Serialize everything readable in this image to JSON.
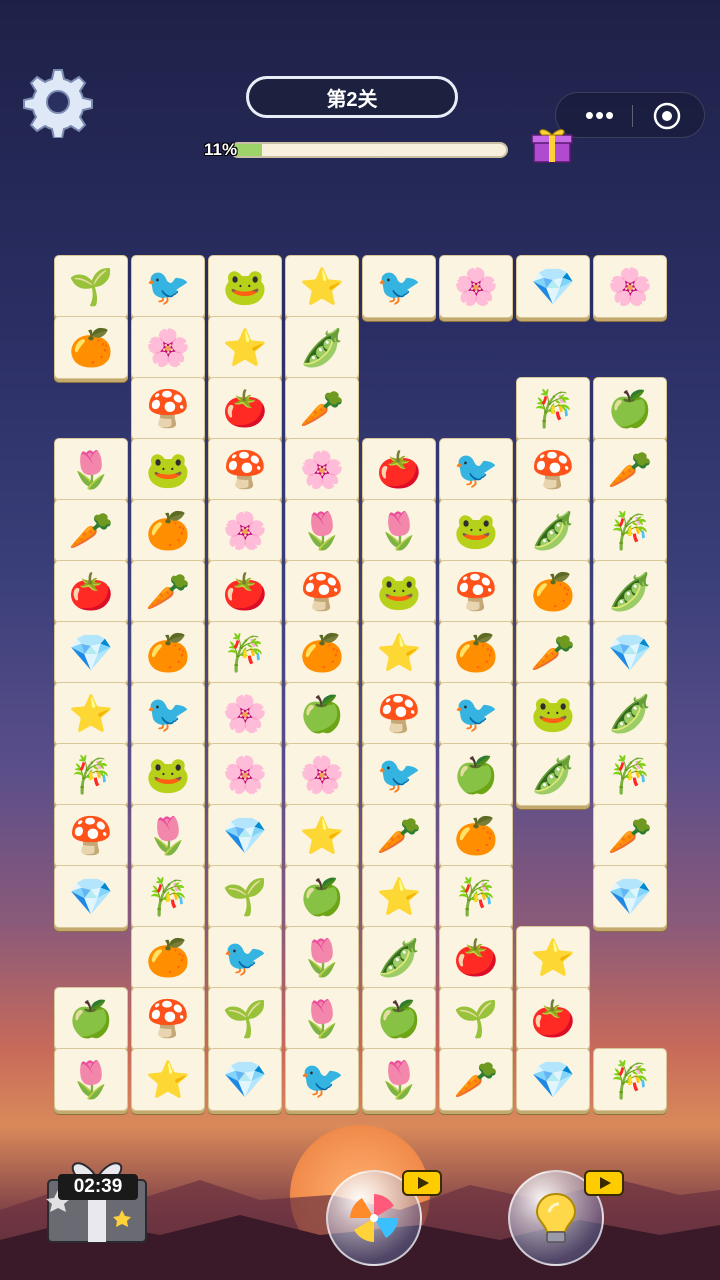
{
  "header": {
    "level_label": "第2关",
    "progress_text": "11%",
    "progress_value": 0.11
  },
  "controls": {
    "settings_icon": "gear-icon",
    "more_icon": "more-dots-icon",
    "close_icon": "target-circle-icon",
    "gift_icon": "gift-box-icon"
  },
  "board": {
    "tiles": [
      {
        "c": 0,
        "r": 0,
        "t": "🌱"
      },
      {
        "c": 1,
        "r": 0,
        "t": "🐦"
      },
      {
        "c": 2,
        "r": 0,
        "t": "🐸"
      },
      {
        "c": 3,
        "r": 0,
        "t": "⭐"
      },
      {
        "c": 4,
        "r": 0,
        "t": "🐦"
      },
      {
        "c": 5,
        "r": 0,
        "t": "🌸"
      },
      {
        "c": 6,
        "r": 0,
        "t": "💎"
      },
      {
        "c": 7,
        "r": 0,
        "t": "🌸"
      },
      {
        "c": 0,
        "r": 1,
        "t": "🍊"
      },
      {
        "c": 1,
        "r": 1,
        "t": "🌸"
      },
      {
        "c": 2,
        "r": 1,
        "t": "⭐"
      },
      {
        "c": 3,
        "r": 1,
        "t": "🫛"
      },
      {
        "c": 1,
        "r": 2,
        "t": "🍄"
      },
      {
        "c": 2,
        "r": 2,
        "t": "🍅"
      },
      {
        "c": 3,
        "r": 2,
        "t": "🥕"
      },
      {
        "c": 6,
        "r": 2,
        "t": "🎋"
      },
      {
        "c": 7,
        "r": 2,
        "t": "🍏"
      },
      {
        "c": 0,
        "r": 3,
        "t": "🌷"
      },
      {
        "c": 1,
        "r": 3,
        "t": "🐸"
      },
      {
        "c": 2,
        "r": 3,
        "t": "🍄"
      },
      {
        "c": 3,
        "r": 3,
        "t": "🌸"
      },
      {
        "c": 4,
        "r": 3,
        "t": "🍅"
      },
      {
        "c": 5,
        "r": 3,
        "t": "🐦"
      },
      {
        "c": 6,
        "r": 3,
        "t": "🍄"
      },
      {
        "c": 7,
        "r": 3,
        "t": "🥕"
      },
      {
        "c": 0,
        "r": 4,
        "t": "🥕"
      },
      {
        "c": 1,
        "r": 4,
        "t": "🍊"
      },
      {
        "c": 2,
        "r": 4,
        "t": "🌸"
      },
      {
        "c": 3,
        "r": 4,
        "t": "🌷"
      },
      {
        "c": 4,
        "r": 4,
        "t": "🌷"
      },
      {
        "c": 5,
        "r": 4,
        "t": "🐸"
      },
      {
        "c": 6,
        "r": 4,
        "t": "🫛"
      },
      {
        "c": 7,
        "r": 4,
        "t": "🎋"
      },
      {
        "c": 0,
        "r": 5,
        "t": "🍅"
      },
      {
        "c": 1,
        "r": 5,
        "t": "🥕"
      },
      {
        "c": 2,
        "r": 5,
        "t": "🍅"
      },
      {
        "c": 3,
        "r": 5,
        "t": "🍄"
      },
      {
        "c": 4,
        "r": 5,
        "t": "🐸"
      },
      {
        "c": 5,
        "r": 5,
        "t": "🍄"
      },
      {
        "c": 6,
        "r": 5,
        "t": "🍊"
      },
      {
        "c": 7,
        "r": 5,
        "t": "🫛"
      },
      {
        "c": 0,
        "r": 6,
        "t": "💎"
      },
      {
        "c": 1,
        "r": 6,
        "t": "🍊"
      },
      {
        "c": 2,
        "r": 6,
        "t": "🎋"
      },
      {
        "c": 3,
        "r": 6,
        "t": "🍊"
      },
      {
        "c": 4,
        "r": 6,
        "t": "⭐"
      },
      {
        "c": 5,
        "r": 6,
        "t": "🍊"
      },
      {
        "c": 6,
        "r": 6,
        "t": "🥕"
      },
      {
        "c": 7,
        "r": 6,
        "t": "💎"
      },
      {
        "c": 0,
        "r": 7,
        "t": "⭐"
      },
      {
        "c": 1,
        "r": 7,
        "t": "🐦"
      },
      {
        "c": 2,
        "r": 7,
        "t": "🌸"
      },
      {
        "c": 3,
        "r": 7,
        "t": "🍏"
      },
      {
        "c": 4,
        "r": 7,
        "t": "🍄"
      },
      {
        "c": 5,
        "r": 7,
        "t": "🐦"
      },
      {
        "c": 6,
        "r": 7,
        "t": "🐸"
      },
      {
        "c": 7,
        "r": 7,
        "t": "🫛"
      },
      {
        "c": 0,
        "r": 8,
        "t": "🎋"
      },
      {
        "c": 1,
        "r": 8,
        "t": "🐸"
      },
      {
        "c": 2,
        "r": 8,
        "t": "🌸"
      },
      {
        "c": 3,
        "r": 8,
        "t": "🌸"
      },
      {
        "c": 4,
        "r": 8,
        "t": "🐦"
      },
      {
        "c": 5,
        "r": 8,
        "t": "🍏"
      },
      {
        "c": 6,
        "r": 8,
        "t": "🫛"
      },
      {
        "c": 7,
        "r": 8,
        "t": "🎋"
      },
      {
        "c": 0,
        "r": 9,
        "t": "🍄"
      },
      {
        "c": 1,
        "r": 9,
        "t": "🌷"
      },
      {
        "c": 2,
        "r": 9,
        "t": "💎"
      },
      {
        "c": 3,
        "r": 9,
        "t": "⭐"
      },
      {
        "c": 4,
        "r": 9,
        "t": "🥕"
      },
      {
        "c": 5,
        "r": 9,
        "t": "🍊"
      },
      {
        "c": 7,
        "r": 9,
        "t": "🥕"
      },
      {
        "c": 0,
        "r": 10,
        "t": "💎"
      },
      {
        "c": 1,
        "r": 10,
        "t": "🎋"
      },
      {
        "c": 2,
        "r": 10,
        "t": "🌱"
      },
      {
        "c": 3,
        "r": 10,
        "t": "🍏"
      },
      {
        "c": 4,
        "r": 10,
        "t": "⭐"
      },
      {
        "c": 5,
        "r": 10,
        "t": "🎋"
      },
      {
        "c": 7,
        "r": 10,
        "t": "💎"
      },
      {
        "c": 1,
        "r": 11,
        "t": "🍊"
      },
      {
        "c": 2,
        "r": 11,
        "t": "🐦"
      },
      {
        "c": 3,
        "r": 11,
        "t": "🌷"
      },
      {
        "c": 4,
        "r": 11,
        "t": "🫛"
      },
      {
        "c": 5,
        "r": 11,
        "t": "🍅"
      },
      {
        "c": 6,
        "r": 11,
        "t": "⭐"
      },
      {
        "c": 0,
        "r": 12,
        "t": "🍏"
      },
      {
        "c": 1,
        "r": 12,
        "t": "🍄"
      },
      {
        "c": 2,
        "r": 12,
        "t": "🌱"
      },
      {
        "c": 3,
        "r": 12,
        "t": "🌷"
      },
      {
        "c": 4,
        "r": 12,
        "t": "🍏"
      },
      {
        "c": 5,
        "r": 12,
        "t": "🌱"
      },
      {
        "c": 6,
        "r": 12,
        "t": "🍅"
      },
      {
        "c": 0,
        "r": 13,
        "t": "🌷"
      },
      {
        "c": 1,
        "r": 13,
        "t": "⭐"
      },
      {
        "c": 2,
        "r": 13,
        "t": "💎"
      },
      {
        "c": 3,
        "r": 13,
        "t": "🐦"
      },
      {
        "c": 4,
        "r": 13,
        "t": "🌷"
      },
      {
        "c": 5,
        "r": 13,
        "t": "🥕"
      },
      {
        "c": 6,
        "r": 13,
        "t": "💎"
      },
      {
        "c": 7,
        "r": 13,
        "t": "🎋"
      }
    ]
  },
  "footer": {
    "timer": "02:39",
    "shuffle_icon": "pinwheel-icon",
    "hint_icon": "lightbulb-icon",
    "video_icon": "video-ad-icon"
  }
}
